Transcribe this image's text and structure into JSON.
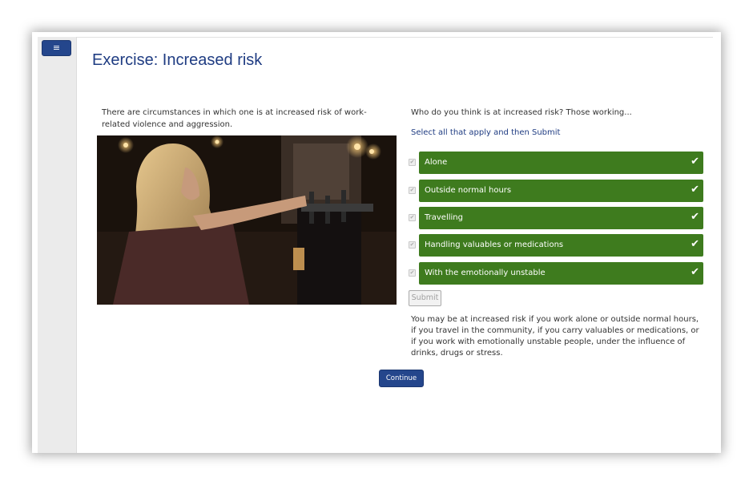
{
  "menu": {
    "icon": "hamburger-menu-icon",
    "label": "≡"
  },
  "page": {
    "title": "Exercise: Increased risk"
  },
  "intro": {
    "text": "There are circumstances in which one is at increased risk of work-related violence and aggression."
  },
  "photo": {
    "description_icon": "bartender-photo"
  },
  "question": {
    "prompt": "Who do you think is at increased risk? Those working...",
    "instruction": "Select all that apply and then Submit",
    "options": [
      {
        "label": "Alone",
        "selected": true,
        "check": "✔"
      },
      {
        "label": "Outside normal hours",
        "selected": true,
        "check": "✔"
      },
      {
        "label": "Travelling",
        "selected": true,
        "check": "✔"
      },
      {
        "label": "Handling valuables or medications",
        "selected": true,
        "check": "✔"
      },
      {
        "label": "With the emotionally unstable",
        "selected": true,
        "check": "✔"
      }
    ],
    "submit_label": "Submit",
    "feedback": "You may be at increased risk if you work alone or outside normal hours, if you travel in the community, if you carry valuables or medications, or if you work with emotionally unstable people, under the influence of drinks, drugs or stress."
  },
  "continue_label": "Continue",
  "colors": {
    "title": "#1f3c82",
    "option_green": "#3e7b1e",
    "primary_button": "#24468c"
  }
}
